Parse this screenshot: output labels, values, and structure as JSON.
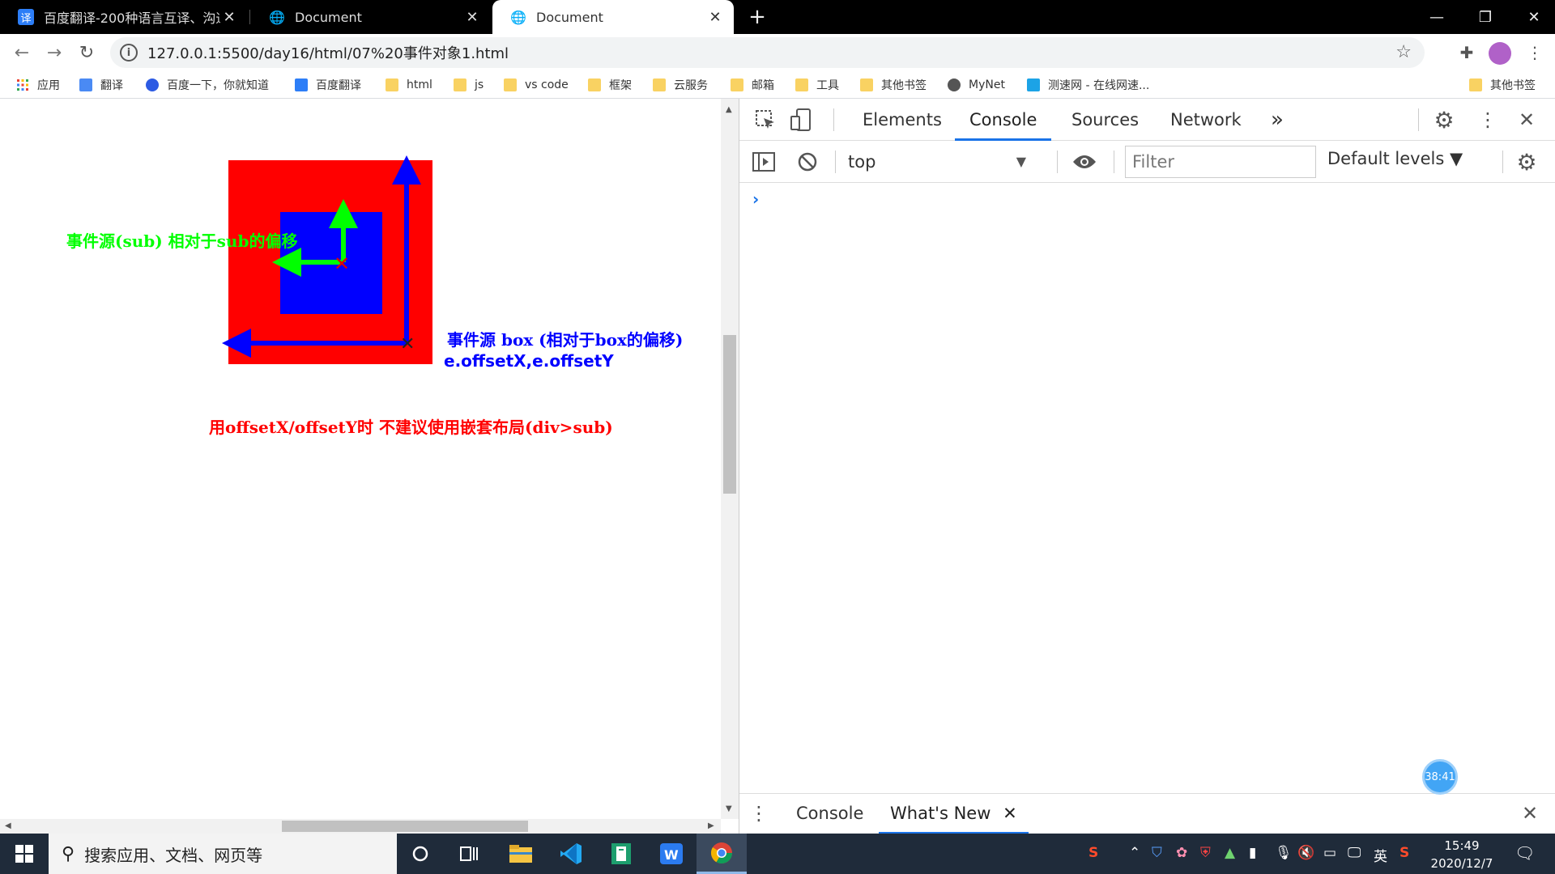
{
  "tabs": [
    {
      "title": "百度翻译-200种语言互译、沟通",
      "icon": "translate-icon",
      "active": false
    },
    {
      "title": "Document",
      "icon": "globe-icon",
      "active": false
    },
    {
      "title": "Document",
      "icon": "globe-icon",
      "active": true
    }
  ],
  "address": {
    "url": "127.0.0.1:5500/day16/html/07%20事件对象1.html"
  },
  "bookmarks": [
    {
      "label": "应用",
      "icon": "apps-grid-icon"
    },
    {
      "label": "翻译",
      "icon": "translate-icon"
    },
    {
      "label": "百度一下，你就知道",
      "icon": "baidu-paw-icon"
    },
    {
      "label": "百度翻译",
      "icon": "translate-icon"
    },
    {
      "label": "html",
      "icon": "folder-icon"
    },
    {
      "label": "js",
      "icon": "folder-icon"
    },
    {
      "label": "vs code",
      "icon": "folder-icon"
    },
    {
      "label": "框架",
      "icon": "folder-icon"
    },
    {
      "label": "云服务",
      "icon": "folder-icon"
    },
    {
      "label": "邮箱",
      "icon": "folder-icon"
    },
    {
      "label": "工具",
      "icon": "folder-icon"
    },
    {
      "label": "其他书签",
      "icon": "folder-icon"
    },
    {
      "label": "MyNet",
      "icon": "globe-icon"
    },
    {
      "label": "测速网 - 在线网速...",
      "icon": "speedtest-icon"
    }
  ],
  "bookmarks_other": "其他书签",
  "page": {
    "sub_annotation": "事件源(sub) 相对于sub的偏移",
    "box_annotation": "事件源  box  (相对于box的偏移)",
    "offset_props": "e.offsetX,e.offsetY",
    "warning": "用offsetX/offsetY时 不建议使用嵌套布局(div>sub)",
    "colors": {
      "box": "#ff0000",
      "sub": "#0000ff",
      "green": "#00ff00",
      "blue": "#0000ff",
      "red": "#ff0000"
    }
  },
  "devtools": {
    "tabs": [
      "Elements",
      "Console",
      "Sources",
      "Network"
    ],
    "active_tab": "Console",
    "more_tabs": "»",
    "context": "top",
    "filter_placeholder": "Filter",
    "levels": "Default levels ▼",
    "prompt": "›",
    "drawer_tabs": [
      "Console",
      "What's New"
    ],
    "drawer_active": "What's New",
    "timer": "38:41"
  },
  "taskbar": {
    "search_placeholder": "搜索应用、文档、网页等",
    "ime": "英",
    "time": "15:49",
    "date": "2020/12/7"
  }
}
